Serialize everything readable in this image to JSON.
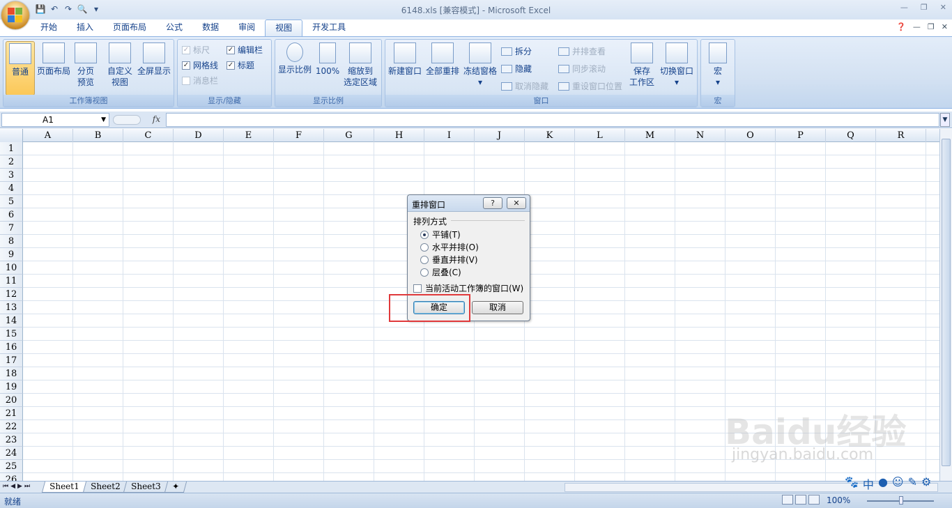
{
  "window": {
    "title": "6148.xls  [兼容模式] - Microsoft Excel"
  },
  "ribbon_tabs": [
    "开始",
    "插入",
    "页面布局",
    "公式",
    "数据",
    "审阅",
    "视图",
    "开发工具"
  ],
  "active_tab": "视图",
  "groups": {
    "workbook_views": {
      "label": "工作簿视图",
      "normal": "普通",
      "page_layout": "页面布局",
      "page_break_line1": "分页",
      "page_break_line2": "预览",
      "custom_line1": "自定义",
      "custom_line2": "视图",
      "fullscreen": "全屏显示"
    },
    "show_hide": {
      "label": "显示/隐藏",
      "ruler": "标尺",
      "gridlines": "网格线",
      "message_bar": "消息栏",
      "formula_bar": "编辑栏",
      "headings": "标题"
    },
    "zoom": {
      "label": "显示比例",
      "zoom": "显示比例",
      "hundred": "100%",
      "selection_line1": "缩放到",
      "selection_line2": "选定区域"
    },
    "window": {
      "label": "窗口",
      "new_window": "新建窗口",
      "arrange_all": "全部重排",
      "freeze_panes": "冻结窗格",
      "split": "拆分",
      "hide": "隐藏",
      "unhide": "取消隐藏",
      "side_by_side": "并排查看",
      "sync_scroll": "同步滚动",
      "reset_position": "重设窗口位置",
      "save_ws_line1": "保存",
      "save_ws_line2": "工作区",
      "switch_windows": "切换窗口"
    },
    "macros": {
      "label": "宏",
      "macro": "宏"
    }
  },
  "formula_bar": {
    "name_box": "A1",
    "fx": "fx"
  },
  "columns": [
    "A",
    "B",
    "C",
    "D",
    "E",
    "F",
    "G",
    "H",
    "I",
    "J",
    "K",
    "L",
    "M",
    "N",
    "O",
    "P",
    "Q",
    "R"
  ],
  "rows": [
    "1",
    "2",
    "3",
    "4",
    "5",
    "6",
    "7",
    "8",
    "9",
    "10",
    "11",
    "12",
    "13",
    "14",
    "15",
    "16",
    "17",
    "18",
    "19",
    "20",
    "21",
    "22",
    "23",
    "24",
    "25",
    "26"
  ],
  "sheets": [
    "Sheet1",
    "Sheet2",
    "Sheet3"
  ],
  "status": {
    "ready": "就绪",
    "zoom": "100%"
  },
  "dialog": {
    "title": "重排窗口",
    "help": "?",
    "close": "✕",
    "group_label": "排列方式",
    "options": [
      "平铺(T)",
      "水平并排(O)",
      "垂直并排(V)",
      "层叠(C)"
    ],
    "selected_option": "平铺(T)",
    "checkbox": "当前活动工作簿的窗口(W)",
    "ok": "确定",
    "cancel": "取消"
  },
  "annotation_color": "#e0393b",
  "watermark": {
    "main": "Baidu经验",
    "url": "jingyan.baidu.com"
  }
}
